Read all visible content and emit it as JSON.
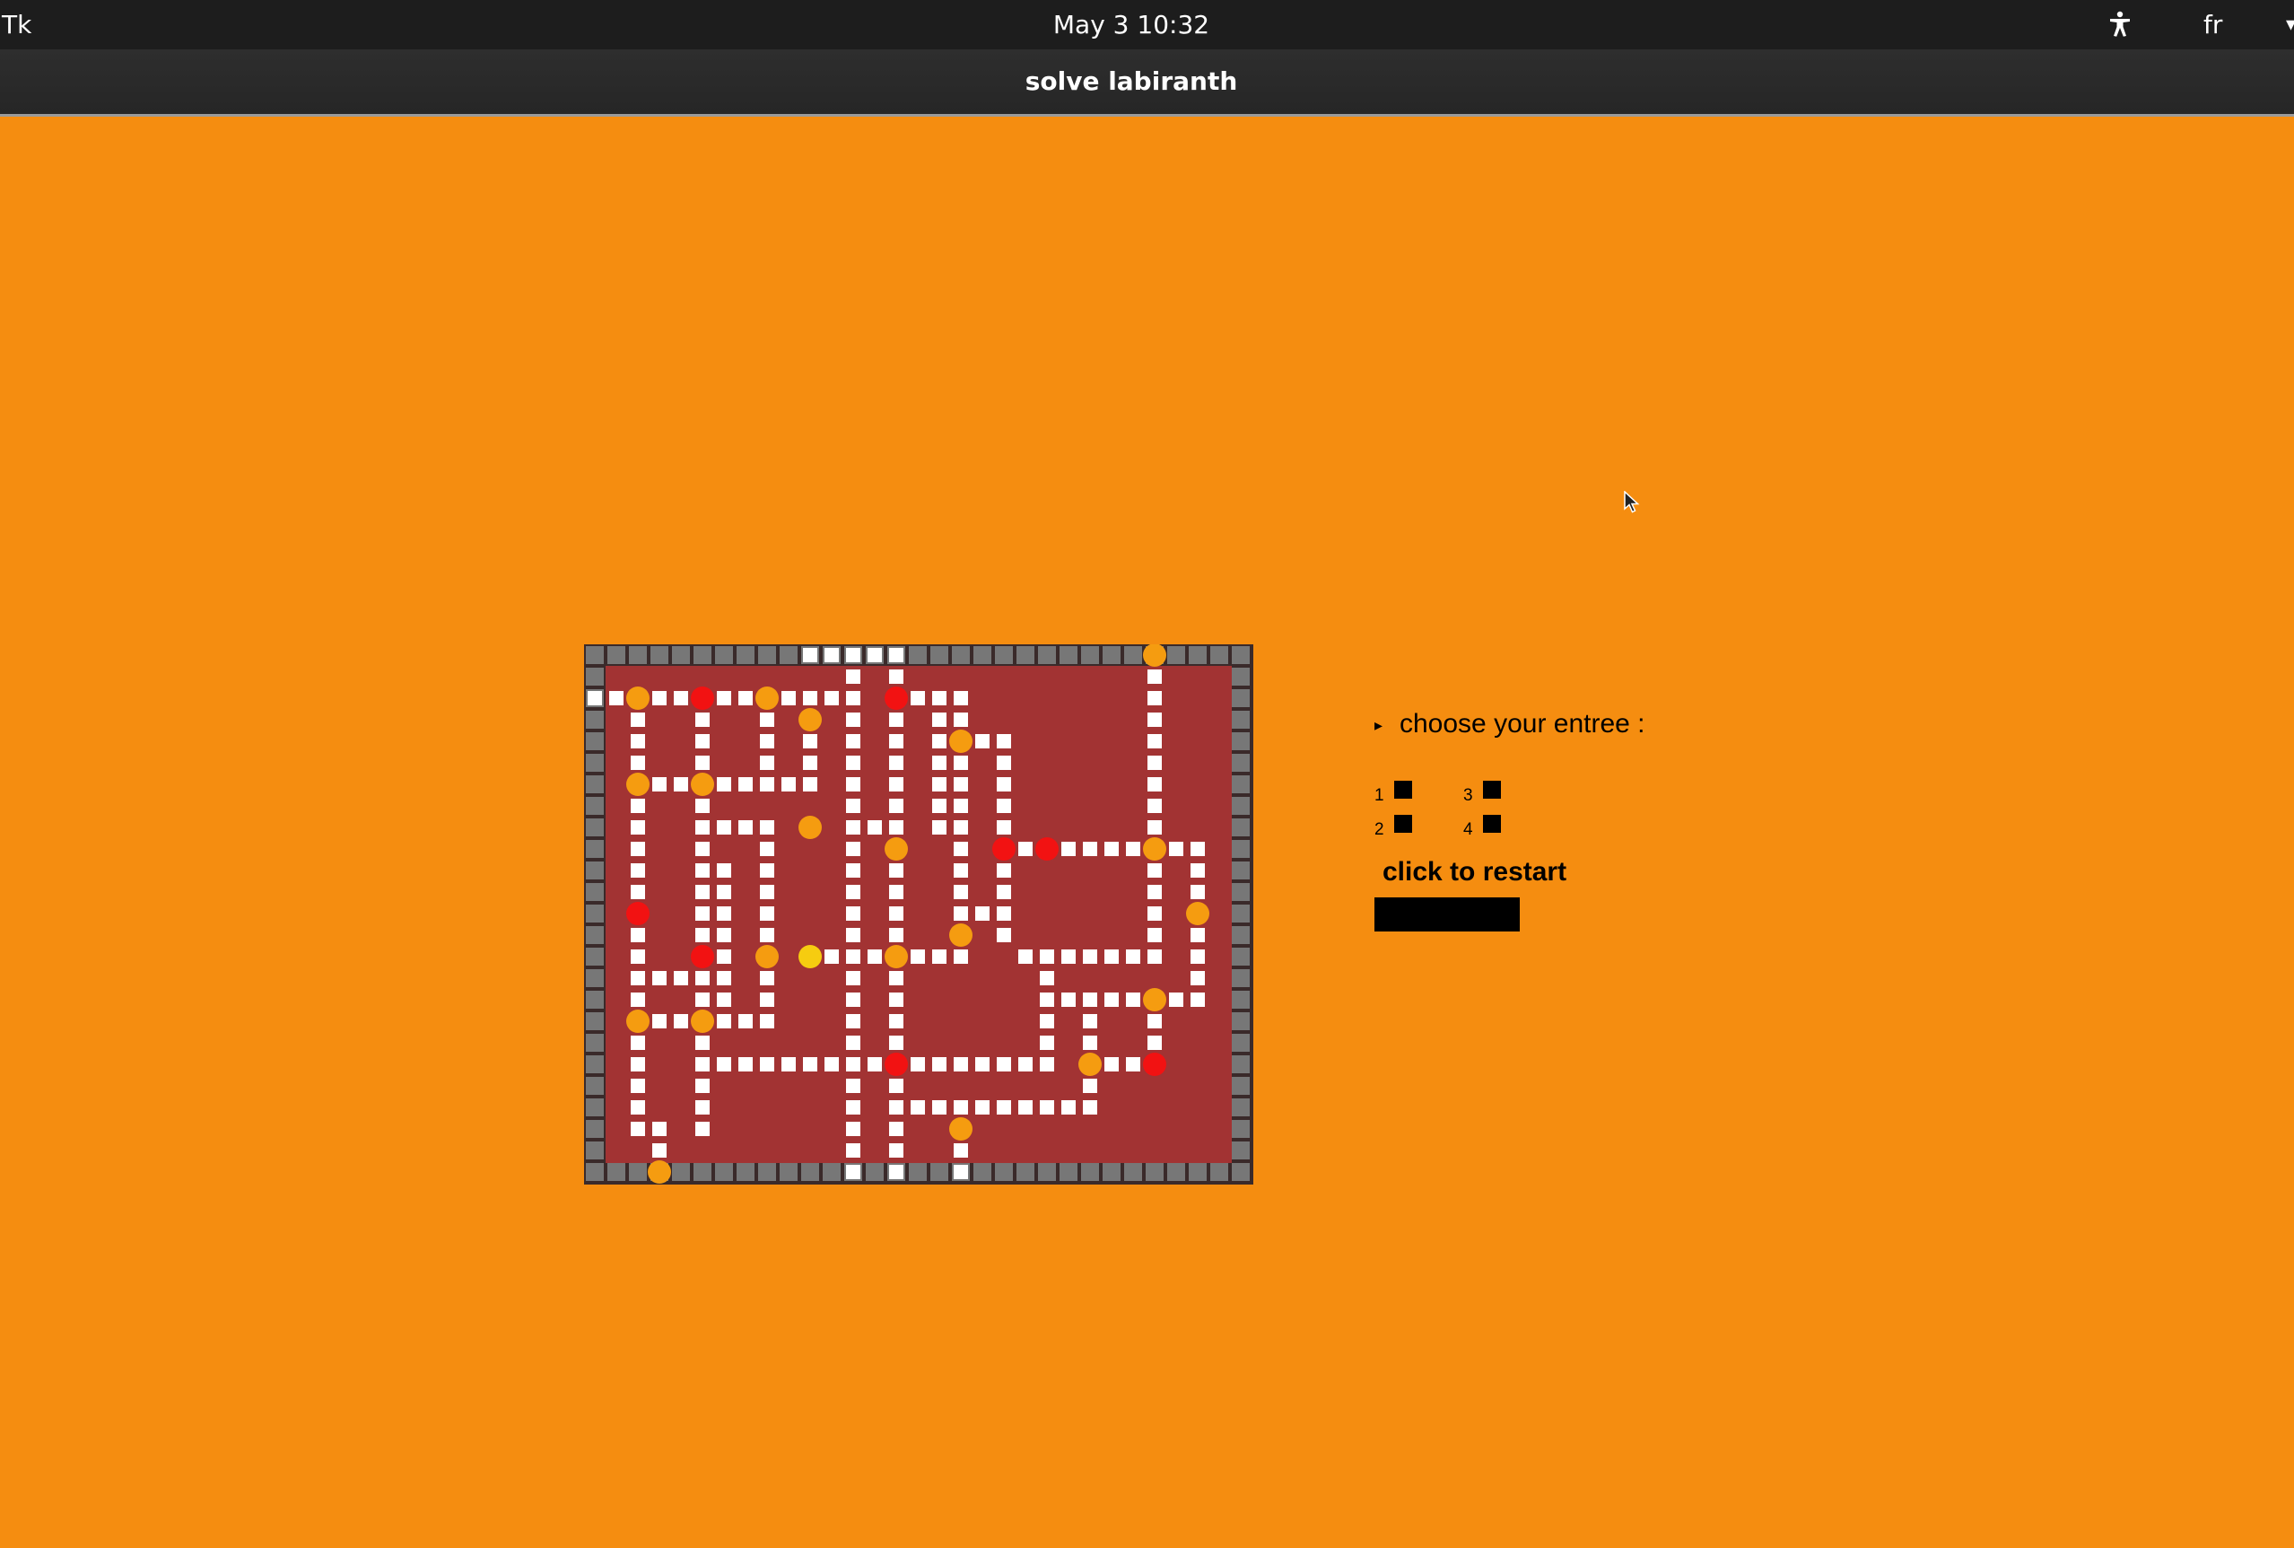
{
  "topbar": {
    "activities": "Tk",
    "clock": "May 3  10:32",
    "lang": "fr",
    "accessibility_icon": "accessibility-icon",
    "menu_icon": "chevron-down-icon"
  },
  "window": {
    "title": "solve labiranth"
  },
  "maze": {
    "colors": {
      "floor": "#a23333",
      "wall": "#777777",
      "path": "#ffffff",
      "orange_node": "#f59c10",
      "red_node": "#f21212",
      "yellow_node": "#f6cc10"
    },
    "node_counts": {
      "orange": 20,
      "red": 8,
      "yellow": 1
    }
  },
  "panel": {
    "prompt_icon": "triangle-right-icon",
    "prompt": "choose your entree :",
    "options": [
      {
        "label": "1"
      },
      {
        "label": "2"
      },
      {
        "label": "3"
      },
      {
        "label": "4"
      }
    ],
    "restart_label": "click to restart"
  }
}
